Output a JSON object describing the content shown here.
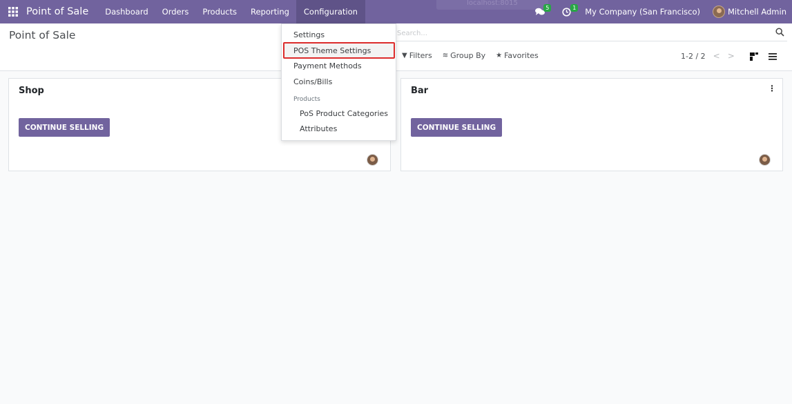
{
  "navbar": {
    "app_name": "Point of Sale",
    "menu": [
      "Dashboard",
      "Orders",
      "Products",
      "Reporting",
      "Configuration"
    ],
    "ghost_tab_text": "localhost:8015",
    "messages_count": "5",
    "activities_count": "1",
    "company": "My Company (San Francisco)",
    "user": "Mitchell Admin",
    "accent_color": "#71639e"
  },
  "control_panel": {
    "title": "Point of Sale",
    "search_placeholder": "Search...",
    "filters_label": "Filters",
    "group_by_label": "Group By",
    "favorites_label": "Favorites",
    "pager": "1-2 / 2"
  },
  "cards": [
    {
      "title": "Shop",
      "button_label": "CONTINUE SELLING"
    },
    {
      "title": "Bar",
      "button_label": "CONTINUE SELLING"
    }
  ],
  "dropdown": {
    "items": [
      "Settings",
      "POS Theme Settings",
      "Payment Methods",
      "Coins/Bills"
    ],
    "section_header": "Products",
    "sub_items": [
      "PoS Product Categories",
      "Attributes"
    ],
    "highlighted": "POS Theme Settings"
  }
}
